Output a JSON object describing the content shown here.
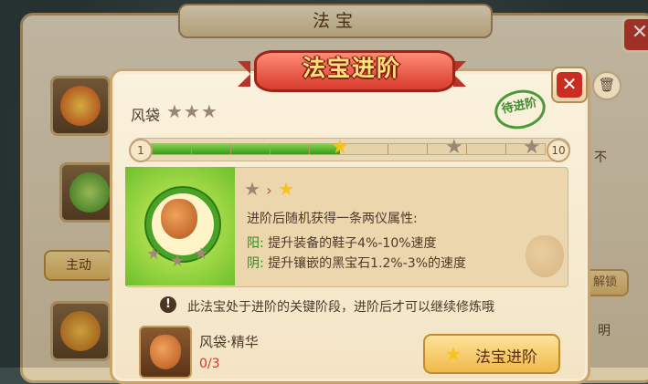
{
  "background": {
    "window_title": "法宝",
    "tab_main": "主动",
    "side_label_1": "不",
    "side_label_2": "解锁",
    "side_label_3": "明"
  },
  "dialog": {
    "banner": "法宝进阶",
    "close_symbol": "✕",
    "item_name": "风袋",
    "current_stars": 3,
    "stamp": "待进阶",
    "progress": {
      "min_label": "1",
      "max_label": "10",
      "value": 5,
      "max": 10
    },
    "upgrade_hint": "进阶后随机获得一条两仪属性:",
    "attributes": [
      {
        "key": "阳:",
        "text": "提升装备的鞋子4%-10%速度"
      },
      {
        "key": "阴:",
        "text": "提升镶嵌的黑宝石1.2%-3%的速度"
      }
    ],
    "notice": "此法宝处于进阶的关键阶段，进阶后才可以继续修炼哦",
    "material": {
      "name": "风袋·精华",
      "count": "0/3"
    },
    "advance_button": "法宝进阶"
  },
  "colors": {
    "accent_red": "#d93b2d",
    "progress_green": "#3d9a1d",
    "star_gold": "#f7c21a",
    "star_grey": "#9a8672"
  }
}
